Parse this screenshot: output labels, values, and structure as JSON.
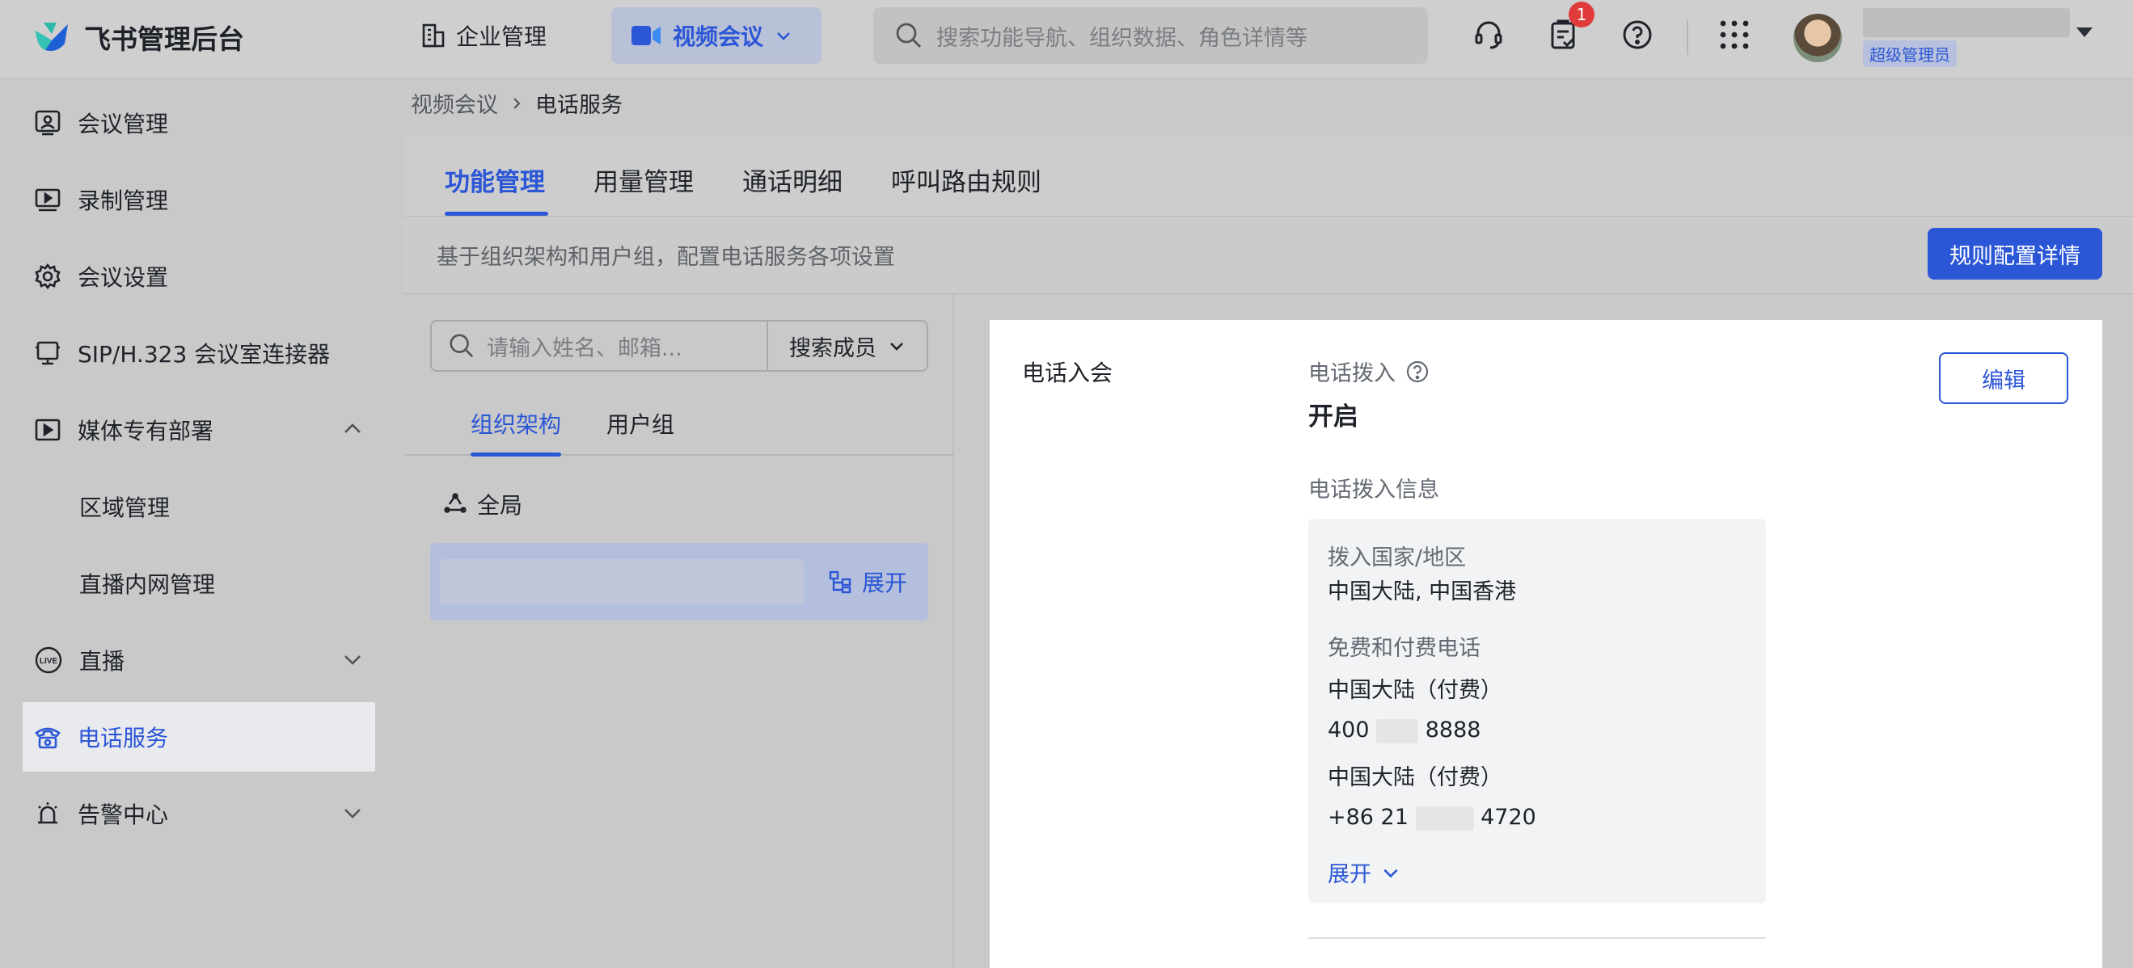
{
  "header": {
    "app_title": "飞书管理后台",
    "enterprise_label": "企业管理",
    "product_label": "视频会议",
    "search_placeholder": "搜索功能导航、组织数据、角色详情等",
    "notification_count": "1",
    "role_tag": "超级管理员"
  },
  "sidebar": {
    "items": [
      {
        "label": "会议管理",
        "icon": "meeting-icon"
      },
      {
        "label": "录制管理",
        "icon": "recording-icon"
      },
      {
        "label": "会议设置",
        "icon": "gear-icon"
      },
      {
        "label": "SIP/H.323 会议室连接器",
        "icon": "room-connector-icon"
      },
      {
        "label": "媒体专有部署",
        "icon": "media-deploy-icon"
      },
      {
        "label": "区域管理"
      },
      {
        "label": "直播内网管理"
      },
      {
        "label": "直播",
        "icon": "live-icon"
      },
      {
        "label": "电话服务",
        "icon": "phone-icon"
      },
      {
        "label": "告警中心",
        "icon": "alarm-icon"
      }
    ]
  },
  "breadcrumb": {
    "parent": "视频会议",
    "current": "电话服务"
  },
  "tabs": [
    "功能管理",
    "用量管理",
    "通话明细",
    "呼叫路由规则"
  ],
  "description": "基于组织架构和用户组，配置电话服务各项设置",
  "rule_button": "规则配置详情",
  "member_search": {
    "placeholder": "请输入姓名、邮箱...",
    "scope": "搜索成员"
  },
  "subtabs": [
    "组织架构",
    "用户组"
  ],
  "tree": {
    "global_label": "全局",
    "expand_label": "展开"
  },
  "detail": {
    "section_title": "电话入会",
    "dial_in_label": "电话拨入",
    "dial_in_value": "开启",
    "edit_button": "编辑",
    "info_title": "电话拨入信息",
    "country_label": "拨入国家/地区",
    "country_value": "中国大陆, 中国香港",
    "phone_label": "免费和付费电话",
    "phone1_region": "中国大陆（付费）",
    "phone1_prefix": "400",
    "phone1_suffix": "8888",
    "phone2_region": "中国大陆（付费）",
    "phone2_prefix": "+86 21",
    "phone2_suffix": "4720",
    "expand_label": "展开"
  },
  "colors": {
    "accent": "#2b56d6",
    "badge": "#e03b3b"
  }
}
